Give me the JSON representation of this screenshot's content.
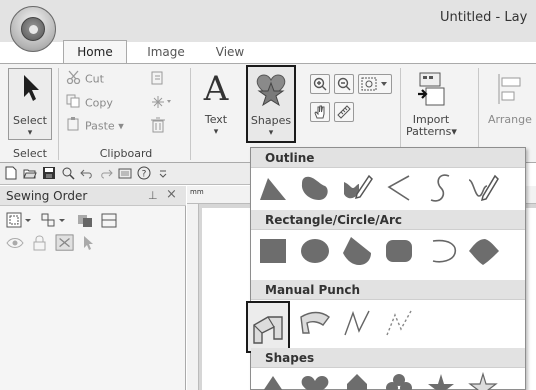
{
  "window": {
    "title": "Untitled - Lay"
  },
  "tabs": [
    {
      "label": "Home"
    },
    {
      "label": "Image"
    },
    {
      "label": "View"
    }
  ],
  "ribbon": {
    "select_group": {
      "button_label": "Select",
      "group_label": "Select"
    },
    "clipboard_group": {
      "cut": "Cut",
      "copy": "Copy",
      "paste": "Paste",
      "group_label": "Clipboard"
    },
    "text_button": "Text",
    "shapes_button": "Shapes",
    "import_button": [
      "Import",
      "Patterns"
    ],
    "arrange_button": "Arrange"
  },
  "sewing_panel": {
    "title": "Sewing Order"
  },
  "ruler": {
    "unit": "mm"
  },
  "shapes_menu": {
    "sections": [
      {
        "title": "Outline",
        "items": [
          "line-polygon",
          "blob",
          "curve-pencil",
          "zigzag-line",
          "s-curve",
          "curve-pencil-2"
        ]
      },
      {
        "title": "Rectangle/Circle/Arc",
        "items": [
          "rectangle",
          "ellipse",
          "fan",
          "rounded-rectangle",
          "arc",
          "diamond-curve"
        ]
      },
      {
        "title": "Manual Punch",
        "items": [
          "punch-polygon",
          "punch-curve",
          "punch-line",
          "punch-dashed-line"
        ]
      },
      {
        "title": "Shapes",
        "items": [
          "triangle",
          "heart",
          "house",
          "clover",
          "star",
          "star-outline"
        ]
      }
    ],
    "selected_item": "punch-polygon"
  },
  "colors": {
    "selection_border": "#1a1a1a",
    "shape_fill": "#6d6d6d",
    "menu_header_bg": "#e2e2e2"
  }
}
